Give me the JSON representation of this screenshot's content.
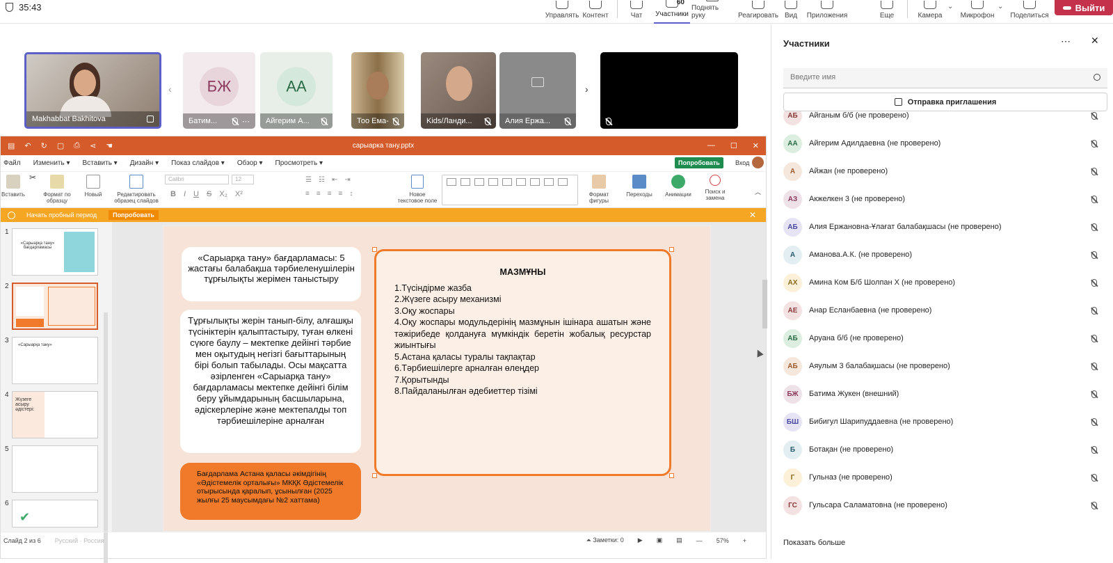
{
  "meeting": {
    "timer": "35:43",
    "toolbar": [
      {
        "label": "Управлять",
        "icon": "manage-icon"
      },
      {
        "label": "Контент",
        "icon": "share-content-icon"
      },
      {
        "label": "Чат",
        "icon": "chat-icon"
      },
      {
        "label": "Участники",
        "icon": "people-icon",
        "count": "60",
        "active": true
      },
      {
        "label": "Поднять руку",
        "icon": "raise-hand-icon"
      },
      {
        "label": "Реагировать",
        "icon": "react-icon"
      },
      {
        "label": "Вид",
        "icon": "view-icon"
      },
      {
        "label": "Приложения",
        "icon": "apps-icon"
      },
      {
        "label": "Еще",
        "icon": "more-icon"
      },
      {
        "label": "Камера",
        "icon": "camera-icon"
      },
      {
        "label": "Микрофон",
        "icon": "microphone-icon"
      },
      {
        "label": "Поделиться",
        "icon": "share-icon"
      }
    ],
    "leave_label": "Выйти",
    "accent": "#5b5fc7",
    "leave_color": "#c4314b"
  },
  "video_tiles": [
    {
      "name": "Makhabbat Bakhitova",
      "type": "video"
    },
    {
      "name": "Батим...",
      "initials": "БЖ",
      "type": "avatar",
      "bg": "#e8d5dc",
      "color": "#8a3a5c"
    },
    {
      "name": "Айгерим А...",
      "initials": "АА",
      "type": "avatar",
      "bg": "#d5e8dc",
      "color": "#2c6b47"
    },
    {
      "name": "Тоо Ема-2...",
      "type": "video"
    },
    {
      "name": "Kids/Ланди...",
      "type": "video"
    },
    {
      "name": "Алия Ержа...",
      "type": "locked"
    },
    {
      "name": "",
      "type": "black"
    }
  ],
  "ppt": {
    "filename": "сарыарка тану.pptx",
    "menu": [
      "Файл",
      "Изменить",
      "Вставить",
      "Дизайн",
      "Показ слайдов",
      "Обзор",
      "Просмотреть"
    ],
    "try_label": "Попробовать",
    "login_label": "Вход",
    "ribbon": {
      "paste": "Вставить",
      "format_painter": "Формат по образцу",
      "new": "Новый",
      "edit_master": "Редактировать образец слайдов",
      "font_name": "Calibri",
      "font_size": "12",
      "new_textbox": "Новое текстовое поле",
      "shape_format": "Формат фигуры",
      "transitions": "Переходы",
      "animations": "Анимации",
      "find_replace": "Поиск и замена"
    },
    "banner": {
      "text": "Начать пробный период",
      "button": "Попробовать"
    },
    "thumbs": [
      {
        "n": "1",
        "text": "«Сарыарқа тану» бағдарламасы"
      },
      {
        "n": "2",
        "text": "",
        "selected": true
      },
      {
        "n": "3",
        "text": "«Сарыарқа тану»"
      },
      {
        "n": "4",
        "text": "Жүзеге асыру әдістері:"
      },
      {
        "n": "5",
        "text": ""
      },
      {
        "n": "6",
        "text": ""
      }
    ],
    "slide": {
      "box1": "«Сарыарқа тану» бағдарламасы: 5 жастағы балабақша тәрбиеленушілерін тұрғылықты жерімен таныстыру",
      "box2": "Тұрғылықты жерін танып-білу, алғашқы түсініктерін қалыптастыру, туған өлкені сүюге баулу – мектепке дейінгі тәрбие мен оқытудың негізгі бағыттарының бірі болып табылады. Осы мақсатта әзірленген «Сарыарқа тану» бағдарламасы мектепке дейінгі білім беру ұйымдарының басшыларына, әдіскерлеріне және мектепалды топ тәрбиешілеріне арналған",
      "box3": "Бағдарлама Астана қаласы әкімдігінің «Әдістемелік орталығы» МКҚК Әдістемелік отырысында қаралып, ұсынылған (2025 жылғы 25 маусымдағы №2 хаттама)",
      "contents_title": "МАЗМҰНЫ",
      "contents": [
        "1.Түсіндірме жазба",
        "2.Жүзеге асыру механизмі",
        "3.Оқу жоспары",
        "4.Оқу жоспары модульдерінің мазмұнын ішінара ашатын және тәжірибеде қолдануға мүмкіндік беретін жобалық ресурстар жиынтығы",
        "5.Астана қаласы туралы тақпақтар",
        "6.Тәрбиешілерге арналған өлеңдер",
        "7.Қорытынды",
        "8.Пайдаланылған әдебиеттер тізімі"
      ]
    },
    "status": {
      "slide": "Слайд 2 из 6",
      "lang": "Русский · Россия",
      "notes": "Заметки: 0",
      "zoom": "57%"
    }
  },
  "participants": {
    "title": "Участники",
    "search_placeholder": "Введите имя",
    "invite_label": "Отправка приглашения",
    "show_more": "Показать больше",
    "list": [
      {
        "initials": "АБ",
        "name": "Айганым б/б (не проверено)"
      },
      {
        "initials": "АА",
        "name": "Айгерим Адилдаевна (не проверено)"
      },
      {
        "initials": "А",
        "name": "Айжан (не проверено)"
      },
      {
        "initials": "АЗ",
        "name": "Акжелкен 3 (не проверено)"
      },
      {
        "initials": "АБ",
        "name": "Алия Ержановна-Ұлағат балабақшасы (не проверено)"
      },
      {
        "initials": "А",
        "name": "Аманова.А.К. (не проверено)"
      },
      {
        "initials": "АХ",
        "name": "Амина Ком Б/б Шолпан Х (не проверено)"
      },
      {
        "initials": "АЕ",
        "name": "Анар Есланбаевна (не проверено)"
      },
      {
        "initials": "АБ",
        "name": "Аруана б/б (не проверено)"
      },
      {
        "initials": "АБ",
        "name": "Аяулым 3 балабақшасы (не проверено)"
      },
      {
        "initials": "БЖ",
        "name": "Батима Жукен (внешний)"
      },
      {
        "initials": "БШ",
        "name": "Бибигул Шарипуддаевна (не проверено)"
      },
      {
        "initials": "Б",
        "name": "Ботақан (не проверено)"
      },
      {
        "initials": "Г",
        "name": "Гульназ (не проверено)"
      },
      {
        "initials": "ГС",
        "name": "Гульсара Саламатовна (не проверено)"
      }
    ]
  }
}
